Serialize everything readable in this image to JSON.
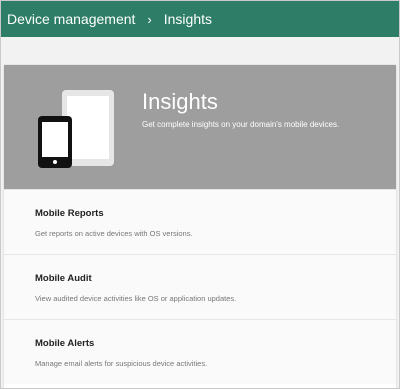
{
  "breadcrumb": {
    "parent": "Device management",
    "separator": "›",
    "current": "Insights"
  },
  "hero": {
    "icon": "mobile-devices-icon",
    "title": "Insights",
    "subtitle": "Get complete insights on your domain's mobile devices."
  },
  "sections": [
    {
      "title": "Mobile Reports",
      "description": "Get reports on active devices with OS versions."
    },
    {
      "title": "Mobile Audit",
      "description": "View audited device activities like OS or application updates."
    },
    {
      "title": "Mobile Alerts",
      "description": "Manage email alerts for suspicious device activities."
    }
  ],
  "colors": {
    "header_bg": "#2e7d67",
    "hero_bg": "#9e9e9e"
  }
}
